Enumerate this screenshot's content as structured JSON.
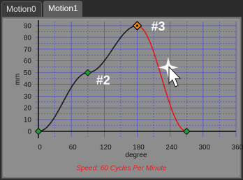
{
  "tabs": [
    {
      "label": "Motion0",
      "active": false
    },
    {
      "label": "Motion1",
      "active": true
    }
  ],
  "chart_data": {
    "type": "line",
    "xlabel": "degree",
    "ylabel": "mm",
    "xlim": [
      0,
      360
    ],
    "ylim": [
      0,
      90
    ],
    "x_ticks": [
      "0",
      "60",
      "120",
      "180",
      "240",
      "300",
      "360"
    ],
    "y_ticks": [
      "0",
      "10",
      "20",
      "30",
      "40",
      "50",
      "60",
      "70",
      "80",
      "90"
    ],
    "grid": true,
    "keypoints": [
      {
        "x": 0,
        "y": 0,
        "label": ""
      },
      {
        "x": 90,
        "y": 50,
        "label": "#2"
      },
      {
        "x": 180,
        "y": 90,
        "label": "#3",
        "selected": true
      },
      {
        "x": 270,
        "y": 0,
        "label": ""
      },
      {
        "x": 360,
        "y": 0,
        "label": ""
      }
    ],
    "segments": [
      {
        "from": 0,
        "to": 1,
        "color": "#1a1a1a"
      },
      {
        "from": 1,
        "to": 2,
        "color": "#1a1a1a"
      },
      {
        "from": 2,
        "to": 3,
        "color": "#e01818"
      },
      {
        "from": 3,
        "to": 4,
        "color": "#1a1a1a"
      }
    ],
    "colors": {
      "grid": "#3a3ad6",
      "axis": "#111111",
      "label": "#ffffff",
      "node": "#1e9a3a",
      "selected_node": "#f08a1c"
    }
  },
  "status": "Speed: 60 Cycles Per Minute"
}
